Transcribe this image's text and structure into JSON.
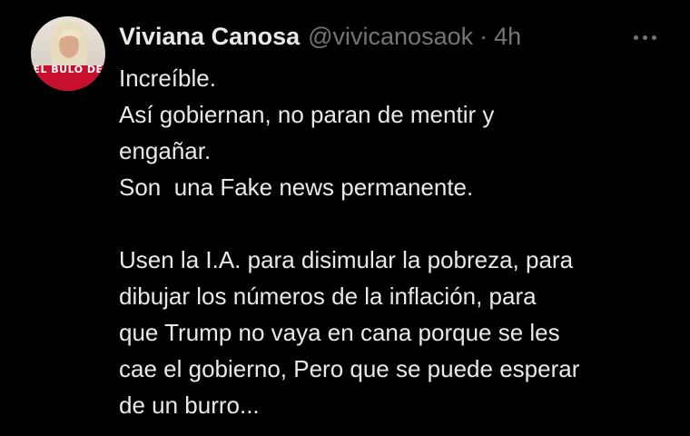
{
  "author": {
    "display_name": "Viviana Canosa",
    "handle": "@vivicanosaok",
    "separator": "·",
    "time": "4h",
    "avatar_caption": "EL BULO DE"
  },
  "more_menu": {
    "icon": "more-horizontal-icon"
  },
  "tweet": {
    "paragraph_1": [
      "Increíble.",
      "Así gobiernan, no paran de mentir y",
      "engañar.",
      "Son  una Fake news permanente."
    ],
    "paragraph_2": [
      "Usen la I.A. para disimular la pobreza, para",
      "dibujar los números de la inflación, para",
      "que Trump no vaya en cana porque se les",
      "cae el gobierno, Pero que se puede esperar",
      "de un burro..."
    ]
  },
  "colors": {
    "background": "#000000",
    "primary_text": "#e7e9ea",
    "secondary_text": "#71767b",
    "avatar_accent": "#c8102e"
  }
}
